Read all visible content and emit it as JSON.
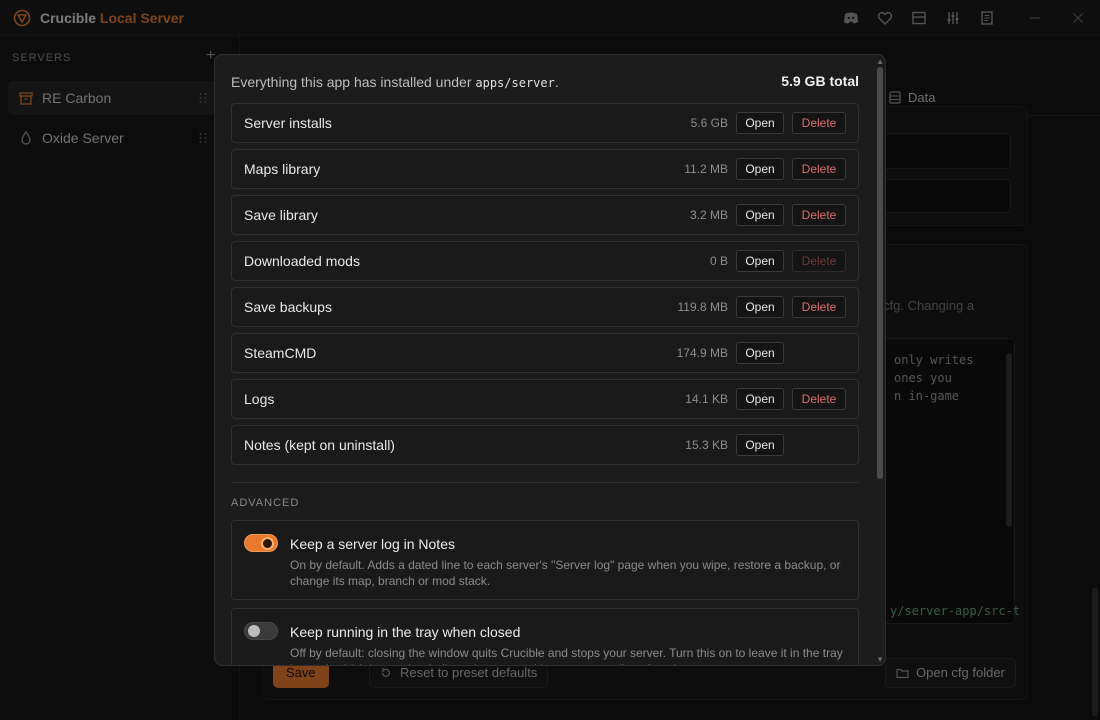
{
  "app": {
    "title_main": "Crucible",
    "title_accent": "Local Server",
    "accent_color": "#e8792e"
  },
  "titlebar_icons": [
    "discord-icon",
    "heart-icon",
    "layout-icon",
    "sliders-icon",
    "notes-icon",
    "minimize-icon",
    "close-icon"
  ],
  "sidebar": {
    "heading": "SERVERS",
    "add_label": "+",
    "servers": [
      {
        "label": "RE Carbon",
        "icon": "box-icon",
        "active": true
      },
      {
        "label": "Oxide Server",
        "icon": "droplet-icon",
        "active": false
      }
    ]
  },
  "background": {
    "tab_data": "Data",
    "cfg_hint": "cfg. Changing a",
    "cfg_lines": [
      "only writes",
      "ones you",
      "n in-game"
    ],
    "cfg_path": "y/server-app/src-t",
    "save_label": "Save",
    "reset_label": "Reset to preset defaults",
    "open_cfg_label": "Open cfg folder"
  },
  "modal": {
    "summary_prefix": "Everything this app has installed under ",
    "summary_path": "apps/server",
    "summary_suffix": ".",
    "total": "5.9 GB total",
    "open_label": "Open",
    "delete_label": "Delete",
    "items": [
      {
        "name": "Server installs",
        "size": "5.6 GB",
        "deletable": true,
        "delete_disabled": false
      },
      {
        "name": "Maps library",
        "size": "11.2 MB",
        "deletable": true,
        "delete_disabled": false
      },
      {
        "name": "Save library",
        "size": "3.2 MB",
        "deletable": true,
        "delete_disabled": false
      },
      {
        "name": "Downloaded mods",
        "size": "0 B",
        "deletable": true,
        "delete_disabled": true
      },
      {
        "name": "Save backups",
        "size": "119.8 MB",
        "deletable": true,
        "delete_disabled": false
      },
      {
        "name": "SteamCMD",
        "size": "174.9 MB",
        "deletable": false,
        "delete_disabled": false
      },
      {
        "name": "Logs",
        "size": "14.1 KB",
        "deletable": true,
        "delete_disabled": false
      },
      {
        "name": "Notes (kept on uninstall)",
        "size": "15.3 KB",
        "deletable": false,
        "delete_disabled": false
      }
    ],
    "advanced": {
      "heading": "ADVANCED",
      "settings": [
        {
          "title": "Keep a server log in Notes",
          "enabled": true,
          "description": "On by default. Adds a dated line to each server's \"Server log\" page when you wipe, restore a backup, or change its map, branch or mod stack."
        },
        {
          "title": "Keep running in the tray when closed",
          "enabled": false,
          "description": "Off by default: closing the window quits Crucible and stops your server. Turn this on to leave it in the tray instead, which keeps the dedicated server and its tray menu alive after close."
        }
      ]
    }
  }
}
